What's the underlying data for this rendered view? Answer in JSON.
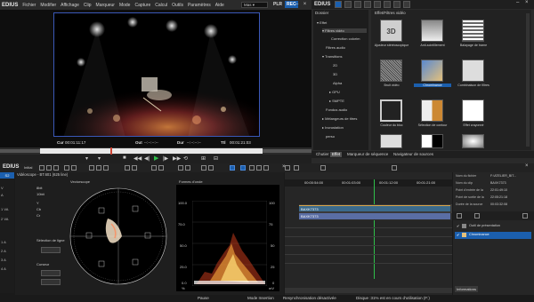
{
  "menubar": {
    "logo": "EDIUS",
    "items": [
      "Fichier",
      "Modifier",
      "Affichage",
      "Clip",
      "Marqueur",
      "Mode",
      "Capture",
      "Calcul",
      "Outils",
      "Paramètres",
      "Aide"
    ],
    "mode_select": "Mas",
    "plr": "PLR",
    "rec": "REC"
  },
  "player": {
    "cur_label": "Cur",
    "cur_time": "00:01:11:17",
    "out_label": "Out",
    "out_time": "--:--:--:--",
    "dur_label": "Dur",
    "dur_time": "--:--:--:--",
    "ttl_label": "Ttl",
    "ttl_time": "00:01:21:03"
  },
  "effects": {
    "logo": "EDIUS",
    "tree_header": "Dossier",
    "tree": [
      "Effet",
      "Filtres vidéo",
      "Correction colorim",
      "Filtres audio",
      "Transitions",
      "2D",
      "3D",
      "Alpha",
      "GPU",
      "SMPTE",
      "Fondus audio",
      "Mélangeurs de titres",
      "Incrustation",
      "perso"
    ],
    "grid_header": "Effet/Filtres vidéo",
    "tiles": [
      "Ajusteur stéréoscopique",
      "Anti-scintillement",
      "Balayage de trame",
      "Bruit vidéo",
      "Chrominance",
      "Combinaison de filtres",
      "Couleur du bloc",
      "Sélection de contour",
      "Effet crayonné",
      "",
      "",
      ""
    ],
    "highlighted_tile": "Chrominance",
    "tabs": [
      "Chutier",
      "Effet",
      "Marqueur de séquence",
      "Navigateur de sources"
    ],
    "active_tab": "Effet"
  },
  "bottom": {
    "logo": "EDIUS",
    "timeline_name": "Initial",
    "tab_label": "S2"
  },
  "scopes": {
    "title": "Vidéoscope - BT.601 (625 line)",
    "vectorscope_label": "Vectorscope",
    "waveform_label": "Formes d'onde",
    "side_labels": [
      "8bit",
      "10bit",
      "Y",
      "Cb",
      "Cr",
      "Sélection de ligne",
      "Curseur"
    ],
    "wf_ticks_left": [
      "100.0",
      "75.0",
      "50.0",
      "25.0",
      "0.0"
    ],
    "wf_ticks_right": [
      "100",
      "75",
      "50",
      "25",
      "0"
    ],
    "wf_unit_left": "%",
    "wf_unit_right": "mV"
  },
  "lstrip": {
    "labels": [
      "V",
      "A",
      "1 VA",
      "2 VA",
      "1 A",
      "2 A",
      "3 A",
      "4 A"
    ]
  },
  "timeline": {
    "ruler": [
      "00:00:54:00",
      "00:01:03:00",
      "00:01:12:00",
      "00:01:21:00"
    ],
    "clip_video": "BAXK7373",
    "clip_audio": "BAXK7373"
  },
  "info": {
    "rows": [
      {
        "k": "Nom du fichier",
        "v": "F:\\ATELIER_BIT..."
      },
      {
        "k": "Nom du clip",
        "v": "BAXK7373"
      },
      {
        "k": "Point d'entrée de la",
        "v": "22:01:49:10"
      },
      {
        "k": "Point de sortie de la",
        "v": "22:05:21:18"
      },
      {
        "k": "Durée de la source",
        "v": "00:03:32:08"
      }
    ],
    "layer_items": [
      "Outil de présentation",
      "Chrominance"
    ],
    "tab": "Informations"
  },
  "status": {
    "pause": "Pause",
    "mode": "Mode Insertion",
    "sync": "Resynchronisation désactivée",
    "disk": "Disque :31% est en cours d'utilisation (F:)"
  }
}
